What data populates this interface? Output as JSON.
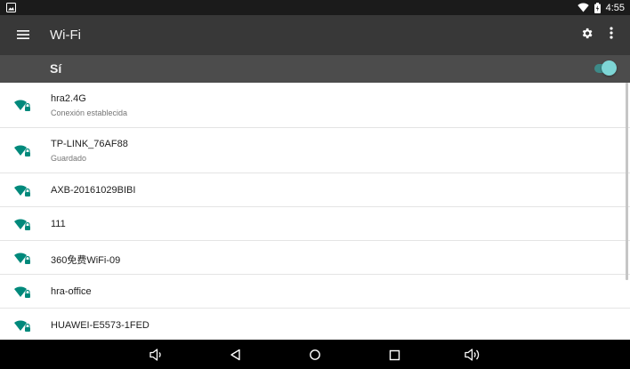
{
  "status_bar": {
    "notification_icon": "image-icon",
    "wifi_icon": "wifi-full-icon",
    "battery_icon": "battery-icon",
    "time": "4:55"
  },
  "toolbar": {
    "menu_icon": "hamburger-menu-icon",
    "title": "Wi-Fi",
    "settings_icon": "gear-icon",
    "more_icon": "more-vertical-icon"
  },
  "master_switch": {
    "label": "Sí",
    "state": "on",
    "accent_color": "#7ed6d6"
  },
  "networks": [
    {
      "name": "hra2.4G",
      "status": "Conexión establecida",
      "icon": "wifi-signal-icon"
    },
    {
      "name": "TP-LINK_76AF88",
      "status": "Guardado",
      "icon": "wifi-signal-icon"
    },
    {
      "name": "AXB-20161029BIBI",
      "status": "",
      "icon": "wifi-signal-icon"
    },
    {
      "name": "111",
      "status": "",
      "icon": "wifi-signal-icon"
    },
    {
      "name": "360免费WiFi-09",
      "status": "",
      "icon": "wifi-signal-icon"
    },
    {
      "name": "hra-office",
      "status": "",
      "icon": "wifi-signal-icon"
    },
    {
      "name": "HUAWEI-E5573-1FED",
      "status": "",
      "icon": "wifi-signal-icon"
    }
  ],
  "nav_bar": {
    "buttons": [
      "volume-down-icon",
      "back-icon",
      "home-icon",
      "recents-icon",
      "volume-up-icon"
    ]
  },
  "colors": {
    "wifi_icon": "#00897b",
    "toolbar": "#383838",
    "switch_bar": "#4c4c4c"
  }
}
